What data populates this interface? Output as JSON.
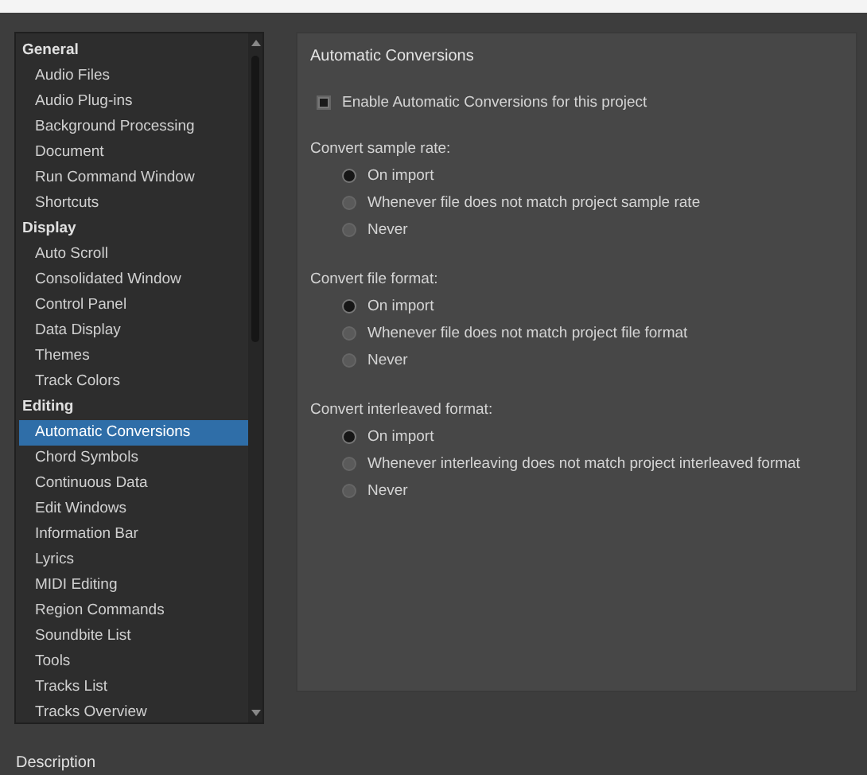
{
  "sidebar": {
    "items": [
      {
        "label": "General",
        "children": [
          {
            "label": "Audio Files",
            "selected": false
          },
          {
            "label": "Audio Plug-ins",
            "selected": false
          },
          {
            "label": "Background Processing",
            "selected": false
          },
          {
            "label": "Document",
            "selected": false
          },
          {
            "label": "Run Command Window",
            "selected": false
          },
          {
            "label": "Shortcuts",
            "selected": false
          }
        ]
      },
      {
        "label": "Display",
        "children": [
          {
            "label": "Auto Scroll",
            "selected": false
          },
          {
            "label": "Consolidated Window",
            "selected": false
          },
          {
            "label": "Control Panel",
            "selected": false
          },
          {
            "label": "Data Display",
            "selected": false
          },
          {
            "label": "Themes",
            "selected": false
          },
          {
            "label": "Track Colors",
            "selected": false
          }
        ]
      },
      {
        "label": "Editing",
        "children": [
          {
            "label": "Automatic Conversions",
            "selected": true
          },
          {
            "label": "Chord Symbols",
            "selected": false
          },
          {
            "label": "Continuous Data",
            "selected": false
          },
          {
            "label": "Edit Windows",
            "selected": false
          },
          {
            "label": "Information Bar",
            "selected": false
          },
          {
            "label": "Lyrics",
            "selected": false
          },
          {
            "label": "MIDI Editing",
            "selected": false
          },
          {
            "label": "Region Commands",
            "selected": false
          },
          {
            "label": "Soundbite List",
            "selected": false
          },
          {
            "label": "Tools",
            "selected": false
          },
          {
            "label": "Tracks List",
            "selected": false
          },
          {
            "label": "Tracks Overview",
            "selected": false
          }
        ]
      }
    ]
  },
  "panel": {
    "title": "Automatic Conversions",
    "enable": {
      "label": "Enable Automatic Conversions for this project",
      "checked": true
    },
    "groups": [
      {
        "label": "Convert sample rate:",
        "options": [
          {
            "label": "On import",
            "selected": true
          },
          {
            "label": "Whenever file does not match project sample rate",
            "selected": false
          },
          {
            "label": "Never",
            "selected": false
          }
        ]
      },
      {
        "label": "Convert file format:",
        "options": [
          {
            "label": "On import",
            "selected": true
          },
          {
            "label": "Whenever file does not match project file format",
            "selected": false
          },
          {
            "label": "Never",
            "selected": false
          }
        ]
      },
      {
        "label": "Convert interleaved format:",
        "options": [
          {
            "label": "On import",
            "selected": true
          },
          {
            "label": "Whenever interleaving does not match project interleaved format",
            "selected": false
          },
          {
            "label": "Never",
            "selected": false
          }
        ]
      }
    ]
  },
  "description": {
    "label": "Description"
  }
}
